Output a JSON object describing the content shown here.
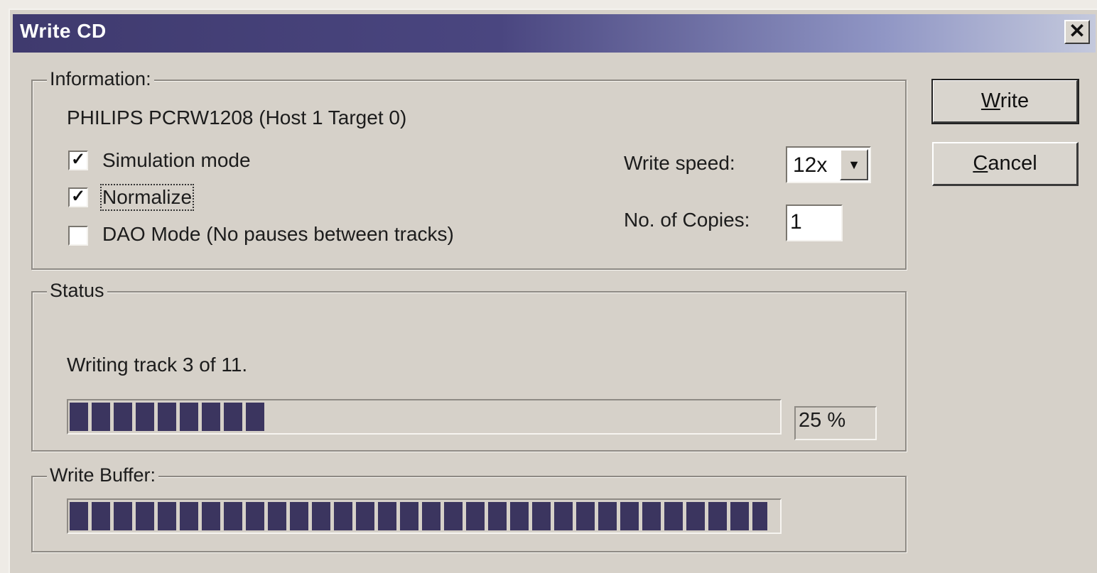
{
  "window": {
    "title": "Write CD",
    "close_label": "✕"
  },
  "information": {
    "group_label": "Information:",
    "device": "PHILIPS PCRW1208 (Host 1 Target 0)",
    "simulation_mode": {
      "label": "Simulation mode",
      "checked": true
    },
    "normalize": {
      "label": "Normalize",
      "checked": true
    },
    "dao_mode": {
      "label": "DAO Mode (No pauses between tracks)",
      "checked": false
    },
    "write_speed_label": "Write speed:",
    "write_speed_value": "12x",
    "copies_label": "No. of Copies:",
    "copies_value": "1"
  },
  "buttons": {
    "write_prefix": "W",
    "write_rest": "rite",
    "cancel_prefix": "C",
    "cancel_rest": "ancel"
  },
  "status": {
    "group_label": "Status",
    "message": "Writing track 3 of 11.",
    "progress_percent": 25,
    "progress_text": "25 %"
  },
  "write_buffer": {
    "group_label": "Write Buffer:",
    "fill_fraction": 0.98
  },
  "colors": {
    "progress_block": "#3b355f",
    "title_bar_start": "#3f3a6e",
    "dialog_face": "#d6d1c9"
  }
}
